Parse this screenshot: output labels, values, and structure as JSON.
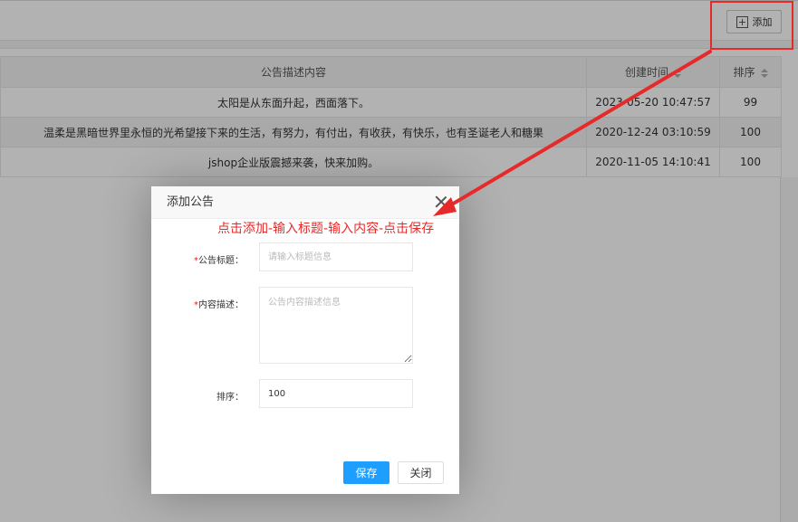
{
  "toolbar": {
    "add_label": "添加"
  },
  "table": {
    "columns": [
      "公告描述内容",
      "创建时间",
      "排序"
    ],
    "rows": [
      {
        "content": "太阳是从东面升起，西面落下。",
        "created": "2023-05-20 10:47:57",
        "sort": "99"
      },
      {
        "content": "温柔是黑暗世界里永恒的光希望接下来的生活，有努力，有付出，有收获，有快乐，也有圣诞老人和糖果",
        "created": "2020-12-24 03:10:59",
        "sort": "100"
      },
      {
        "content": "jshop企业版震撼来袭，快来加购。",
        "created": "2020-11-05 14:10:41",
        "sort": "100"
      }
    ]
  },
  "dialog": {
    "title": "添加公告",
    "required_mark": "*",
    "fields": {
      "title_label": "公告标题：",
      "title_placeholder": "请输入标题信息",
      "title_value": "",
      "content_label": "内容描述：",
      "content_placeholder": "公告内容描述信息",
      "content_value": "",
      "sort_label": "排序：",
      "sort_value": "100"
    },
    "save_label": "保存",
    "close_label": "关闭"
  },
  "annotation": {
    "instruction": "点击添加-输入标题-输入内容-点击保存",
    "color": "#e62a2a"
  },
  "colors": {
    "primary_button": "#1e9fff",
    "required": "#e02020"
  },
  "icons": {
    "add": "plus-square-icon",
    "close": "close-icon",
    "sort": "sort-icon"
  }
}
